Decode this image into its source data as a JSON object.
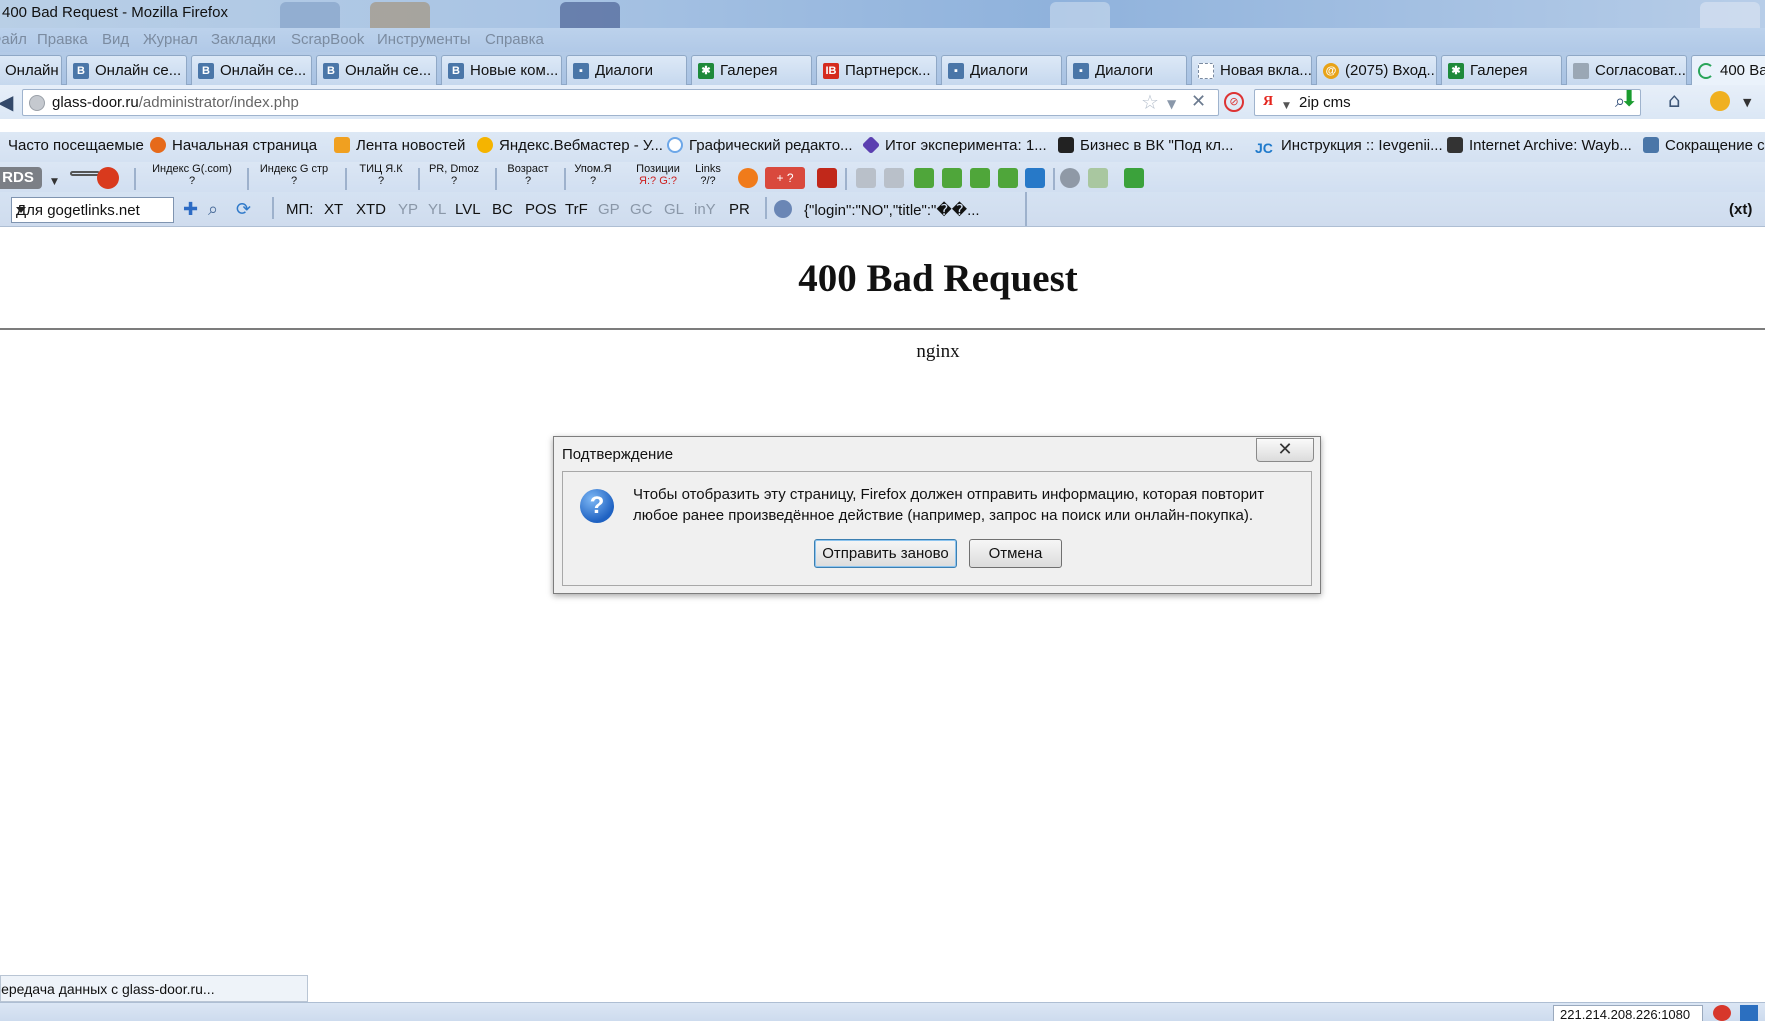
{
  "window": {
    "title": "400 Bad Request - Mozilla Firefox"
  },
  "menu": [
    "Файл",
    "Правка",
    "Вид",
    "Журнал",
    "Закладки",
    "ScrapBook",
    "Инструменты",
    "Справка"
  ],
  "tabs": [
    {
      "label": "Онлайн се...",
      "icon": "vk-icon",
      "color": "#4a76a8"
    },
    {
      "label": "Онлайн се...",
      "icon": "vk-icon",
      "color": "#4a76a8"
    },
    {
      "label": "Онлайн се...",
      "icon": "vk-icon",
      "color": "#4a76a8"
    },
    {
      "label": "Онлайн се...",
      "icon": "vk-icon",
      "color": "#4a76a8"
    },
    {
      "label": "Новые ком...",
      "icon": "vk-icon",
      "color": "#4a76a8"
    },
    {
      "label": "Диалоги",
      "icon": "chat-icon",
      "color": "#4a76a8"
    },
    {
      "label": "Галерея",
      "icon": "joomla-icon",
      "color": "#1f8a3b"
    },
    {
      "label": "Партнерск...",
      "icon": "partner-icon",
      "color": "#d52b1e"
    },
    {
      "label": "Диалоги",
      "icon": "chat-icon",
      "color": "#4a76a8"
    },
    {
      "label": "Диалоги",
      "icon": "chat-icon",
      "color": "#4a76a8"
    },
    {
      "label": "Новая вкла...",
      "icon": "blank-page-icon",
      "color": "#ffffff"
    },
    {
      "label": "(2075) Вход...",
      "icon": "mail-icon",
      "color": "#e8a317"
    },
    {
      "label": "Галерея",
      "icon": "joomla-icon",
      "color": "#1f8a3b"
    },
    {
      "label": "Согласоват...",
      "icon": "doc-icon",
      "color": "#9aa7b5"
    },
    {
      "label": "400 Ba",
      "icon": "loading-icon",
      "color": "#2aa55a"
    }
  ],
  "nav": {
    "url_host": "glass-door.ru",
    "url_path": "/administrator/index.php",
    "search_value": "2ip cms"
  },
  "bookmarks": [
    {
      "label": "Часто посещаемые",
      "color": "#ffffff"
    },
    {
      "label": "Начальная страница",
      "color": "#e66a1a"
    },
    {
      "label": "Лента новостей",
      "color": "#f0a020"
    },
    {
      "label": "Яндекс.Вебмастер - У...",
      "color": "#f5b400"
    },
    {
      "label": "Графический редакто...",
      "color": "#6da7e8"
    },
    {
      "label": "Итог эксперимента: 1...",
      "color": "#5b3fb0"
    },
    {
      "label": "Бизнес в ВК \"Под кл...",
      "color": "#222222"
    },
    {
      "label": "Инструкция :: Ievgenii...",
      "color": "#1f7acb"
    },
    {
      "label": "Internet Archive: Wayb...",
      "color": "#333333"
    },
    {
      "label": "Сокращение с",
      "color": "#4a76a8"
    }
  ],
  "seo": {
    "rds": "RDS",
    "items": [
      {
        "l1": "Индекс G(.com)",
        "l2": "?"
      },
      {
        "l1": "Индекс G стр",
        "l2": "?"
      },
      {
        "l1": "ТИЦ Я.К",
        "l2": "?"
      },
      {
        "l1": "PR, Dmoz",
        "l2": "?"
      },
      {
        "l1": "Возраст",
        "l2": "?"
      },
      {
        "l1": "Упом.Я",
        "l2": "?"
      },
      {
        "l1": "Позиции",
        "l2": "Я:? G:?"
      },
      {
        "l1": "Links",
        "l2": "?/?"
      }
    ],
    "gplus": "+ ?"
  },
  "gg": {
    "select_value": "Для gogetlinks.net",
    "labels": [
      {
        "t": "МП:",
        "dim": false
      },
      {
        "t": "XT",
        "dim": false
      },
      {
        "t": "XTD",
        "dim": false
      },
      {
        "t": "YP",
        "dim": true
      },
      {
        "t": "YL",
        "dim": true
      },
      {
        "t": "LVL",
        "dim": false
      },
      {
        "t": "BC",
        "dim": false
      },
      {
        "t": "POS",
        "dim": false
      },
      {
        "t": "TrF",
        "dim": false
      },
      {
        "t": "GP",
        "dim": true
      },
      {
        "t": "GC",
        "dim": true
      },
      {
        "t": "GL",
        "dim": true
      },
      {
        "t": "inY",
        "dim": true
      },
      {
        "t": "PR",
        "dim": false
      }
    ],
    "json_text": "{\"login\":\"NO\",\"title\":\"��...",
    "xt": "(xt)"
  },
  "page": {
    "heading": "400 Bad Request",
    "server": "nginx"
  },
  "dialog": {
    "title": "Подтверждение",
    "message": "Чтобы отобразить эту страницу, Firefox должен отправить информацию, которая повторит любое ранее произведённое действие (например, запрос на поиск или онлайн-покупка).",
    "resend_label": "Отправить заново",
    "cancel_label": "Отмена"
  },
  "status": {
    "text": "Передача данных с glass-door.ru...",
    "ip": "221.214.208.226:1080"
  }
}
